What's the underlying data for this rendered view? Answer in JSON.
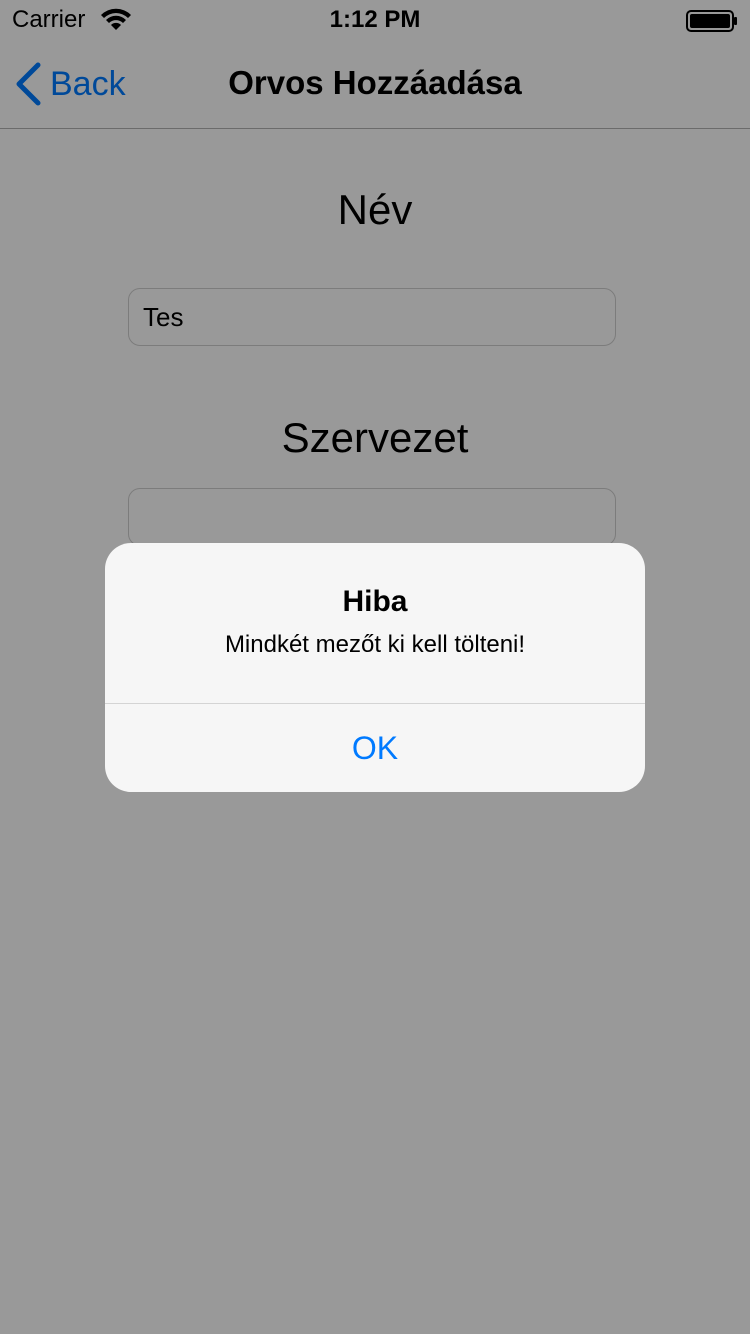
{
  "status_bar": {
    "carrier": "Carrier",
    "time": "1:12 PM",
    "wifi_icon": "wifi-icon",
    "battery_icon": "battery-icon"
  },
  "nav": {
    "back_label": "Back",
    "back_icon": "chevron-left-icon",
    "title": "Orvos Hozzáadása"
  },
  "form": {
    "name_label": "Név",
    "name_value": "Tes",
    "org_label": "Szervezet",
    "org_value": ""
  },
  "alert": {
    "title": "Hiba",
    "message": "Mindkét mezőt ki kell tölteni!",
    "ok_label": "OK"
  },
  "colors": {
    "accent": "#007aff",
    "overlay": "rgba(0,0,0,0.40)",
    "alert_background": "#f8f8f8"
  }
}
